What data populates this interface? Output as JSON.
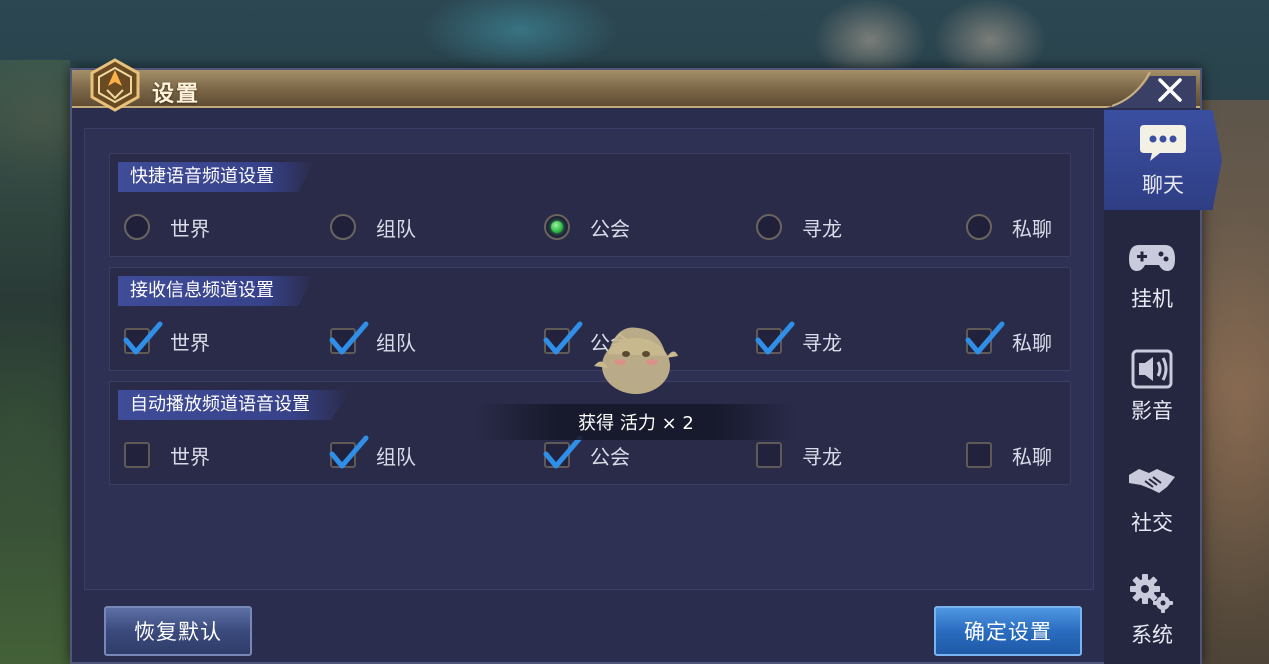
{
  "window": {
    "title": "设置",
    "close_icon": "close-icon"
  },
  "sections": [
    {
      "header": "快捷语音频道设置",
      "control": "radio",
      "options": [
        {
          "label": "世界",
          "checked": false
        },
        {
          "label": "组队",
          "checked": false
        },
        {
          "label": "公会",
          "checked": true
        },
        {
          "label": "寻龙",
          "checked": false
        },
        {
          "label": "私聊",
          "checked": false
        }
      ]
    },
    {
      "header": "接收信息频道设置",
      "control": "checkbox",
      "options": [
        {
          "label": "世界",
          "checked": true
        },
        {
          "label": "组队",
          "checked": true
        },
        {
          "label": "公会",
          "checked": true
        },
        {
          "label": "寻龙",
          "checked": true
        },
        {
          "label": "私聊",
          "checked": true
        }
      ]
    },
    {
      "header": "自动播放频道语音设置",
      "control": "checkbox",
      "options": [
        {
          "label": "世界",
          "checked": false
        },
        {
          "label": "组队",
          "checked": true
        },
        {
          "label": "公会",
          "checked": true
        },
        {
          "label": "寻龙",
          "checked": false
        },
        {
          "label": "私聊",
          "checked": false
        }
      ]
    }
  ],
  "sidebar": {
    "tabs": [
      {
        "label": "聊天",
        "icon": "chat-bubble-icon",
        "active": true
      },
      {
        "label": "挂机",
        "icon": "gamepad-icon",
        "active": false
      },
      {
        "label": "影音",
        "icon": "speaker-icon",
        "active": false
      },
      {
        "label": "社交",
        "icon": "handshake-icon",
        "active": false
      },
      {
        "label": "系统",
        "icon": "gears-icon",
        "active": false
      }
    ]
  },
  "buttons": {
    "restore": "恢复默认",
    "confirm": "确定设置"
  },
  "toast": {
    "text": "获得 活力 × 2"
  },
  "colors": {
    "panel_bg": "#2b2d4e",
    "title_bar": "#8a7552",
    "section_header": "#3f4c98",
    "radio_selected": "#34c24a",
    "checkmark": "#2f8fe8",
    "confirm_button": "#2a6cc0"
  }
}
